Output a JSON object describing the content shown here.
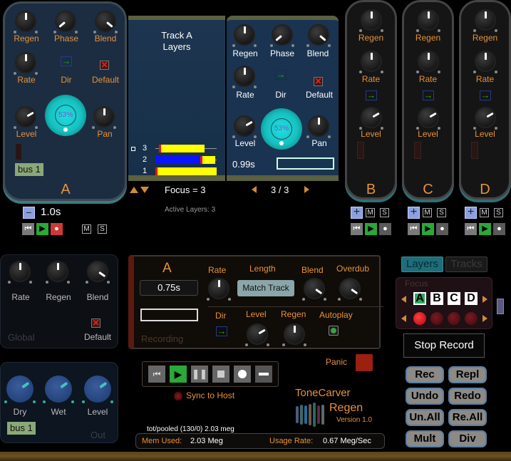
{
  "track_a": {
    "knobs": [
      "Regen",
      "Phase",
      "Blend",
      "Rate",
      "Level",
      "Pan"
    ],
    "dir_label": "Dir",
    "default_label": "Default",
    "phase_percent": "53%",
    "bus": "bus 1",
    "letter": "A",
    "length": "1.0s",
    "mute": "M",
    "solo": "S"
  },
  "layers_panel": {
    "title_line1": "Track A",
    "title_line2": "Layers",
    "layers": [
      {
        "num": "3",
        "start": 0.06,
        "end": 0.8,
        "blue": 0
      },
      {
        "num": "2",
        "start": 0.0,
        "end": 0.98,
        "blue": 0.73
      },
      {
        "num": "1",
        "start": 0.0,
        "end": 1.0,
        "blue": 0
      }
    ],
    "focus": "Focus = 3",
    "active_layers": "Active Layers: 3"
  },
  "layer_detail": {
    "knobs": [
      "Regen",
      "Phase",
      "Blend",
      "Rate",
      "Level",
      "Pan"
    ],
    "dir_label": "Dir",
    "default_label": "Default",
    "phase_percent": "53%",
    "length": "0.99s",
    "page": "3 / 3"
  },
  "tracks": [
    {
      "letter": "B",
      "regen": "Regen",
      "rate": "Rate",
      "level": "Level",
      "mute": "M",
      "solo": "S"
    },
    {
      "letter": "C",
      "regen": "Regen",
      "rate": "Rate",
      "level": "Level",
      "mute": "M",
      "solo": "S"
    },
    {
      "letter": "D",
      "regen": "Regen",
      "rate": "Rate",
      "level": "Level",
      "mute": "M",
      "solo": "S"
    }
  ],
  "global": {
    "knobs": [
      "Rate",
      "Regen",
      "Blend"
    ],
    "default_label": "Default",
    "title": "Global"
  },
  "out": {
    "knobs": [
      "Dry",
      "Wet",
      "Level"
    ],
    "bus": "bus 1",
    "title": "Out"
  },
  "recording": {
    "letter": "A",
    "length": "0.75s",
    "status": "Recording",
    "rate": "Rate",
    "length_label": "Length",
    "match_track": "Match Track",
    "blend": "Blend",
    "overdub": "Overdub",
    "dir": "Dir",
    "level": "Level",
    "regen": "Regen",
    "autoplay": "Autoplay"
  },
  "transport": {
    "sync": "Sync to Host",
    "panic": "Panic"
  },
  "brand": {
    "company": "ToneCarver",
    "product": "Regen",
    "version": "Version 1.0"
  },
  "memory": {
    "pooled": "tot/pooled (130/0) 2.03 meg",
    "mem_label": "Mem Used:",
    "mem_value": "2.03 Meg",
    "rate_label": "Usage Rate:",
    "rate_value": "0.67 Meg/Sec"
  },
  "view_tabs": {
    "layers": "Layers",
    "tracks": "Tracks",
    "active": "Layers"
  },
  "focus": {
    "title": "Focus",
    "tracks": [
      "A",
      "B",
      "C",
      "D"
    ],
    "selected": "A"
  },
  "stop_record": "Stop Record",
  "buttons": [
    "Rec",
    "Repl",
    "Undo",
    "Redo",
    "Un.All",
    "Re.All",
    "Mult",
    "Div"
  ]
}
